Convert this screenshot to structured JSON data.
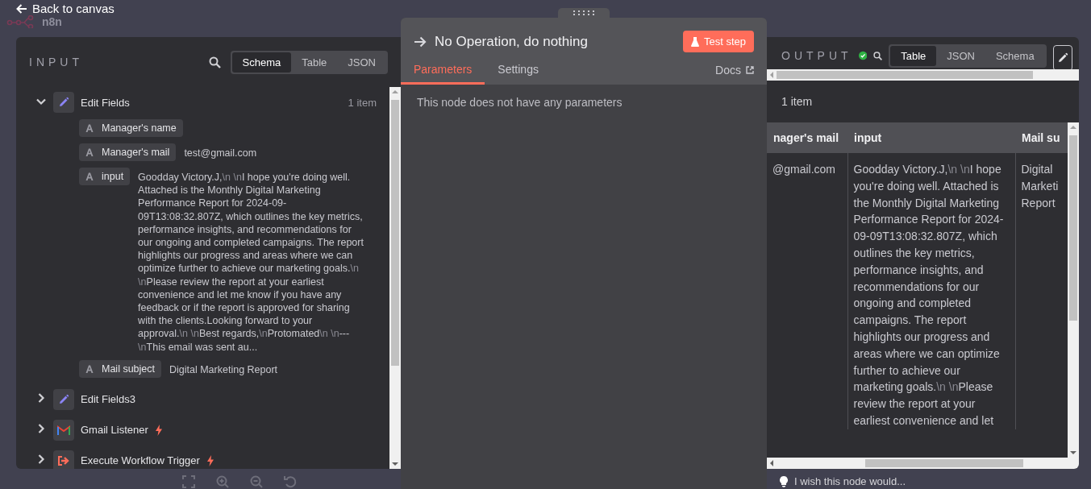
{
  "back_link": "Back to canvas",
  "logo_text": "n8n",
  "input_panel": {
    "title": "INPUT",
    "view_tabs": [
      {
        "label": "Schema",
        "selected": true
      },
      {
        "label": "Table",
        "selected": false
      },
      {
        "label": "JSON",
        "selected": false
      }
    ],
    "nodes": [
      {
        "name": "Edit Fields",
        "kind": "edit",
        "expanded": true,
        "trigger": false,
        "count": "1 item",
        "fields": [
          {
            "name": "Manager's name"
          },
          {
            "name": "Manager's mail",
            "value": "test@gmail.com"
          },
          {
            "name": "input",
            "value": "Goodday Victory.J,\\n \\nI hope you're doing well. Attached is the Monthly Digital Marketing Performance Report for 2024-09-09T13:08:32.807Z, which outlines the key metrics, performance insights, and recommendations for our ongoing and completed campaigns. The report highlights our progress and areas where we can optimize further to achieve our marketing goals.\\n \\nPlease review the report at your earliest convenience and let me know if you have any feedback or if the report is approved for sharing with the clients.Looking forward to your approval.\\n \\nBest regards,\\nProtomated\\n \\n---\\nThis email was sent au..."
          },
          {
            "name": "Mail subject",
            "value": "Digital Marketing Report"
          }
        ]
      },
      {
        "name": "Edit Fields3",
        "kind": "edit",
        "expanded": false,
        "trigger": false
      },
      {
        "name": "Gmail Listener",
        "kind": "gmail",
        "expanded": false,
        "trigger": true
      },
      {
        "name": "Execute Workflow Trigger",
        "kind": "execute",
        "expanded": false,
        "trigger": true
      }
    ]
  },
  "node_panel": {
    "title": "No Operation, do nothing",
    "test_button": "Test step",
    "tabs": [
      {
        "label": "Parameters",
        "selected": true
      },
      {
        "label": "Settings",
        "selected": false
      }
    ],
    "docs_link": "Docs",
    "message": "This node does not have any parameters"
  },
  "output_panel": {
    "title": "OUTPUT",
    "success": true,
    "view_tabs": [
      {
        "label": "Table",
        "selected": true
      },
      {
        "label": "JSON",
        "selected": false
      },
      {
        "label": "Schema",
        "selected": false
      }
    ],
    "count": "1 item",
    "table": {
      "columns": [
        "nager's mail",
        "input",
        "Mail su"
      ],
      "rows": [
        [
          "@gmail.com",
          "Goodday Victory.J,\\n \\nI hope you're doing well. Attached is the Monthly Digital Marketing Performance Report for 2024-09-09T13:08:32.807Z, which outlines the key metrics, performance insights, and recommendations for our ongoing and completed campaigns. The report highlights our progress and areas where we can optimize further to achieve our marketing goals.\\n \\nPlease review the report at your earliest convenience and let",
          "Digital Marketi Report"
        ]
      ]
    }
  },
  "feedback_prompt": "I wish this node would..."
}
